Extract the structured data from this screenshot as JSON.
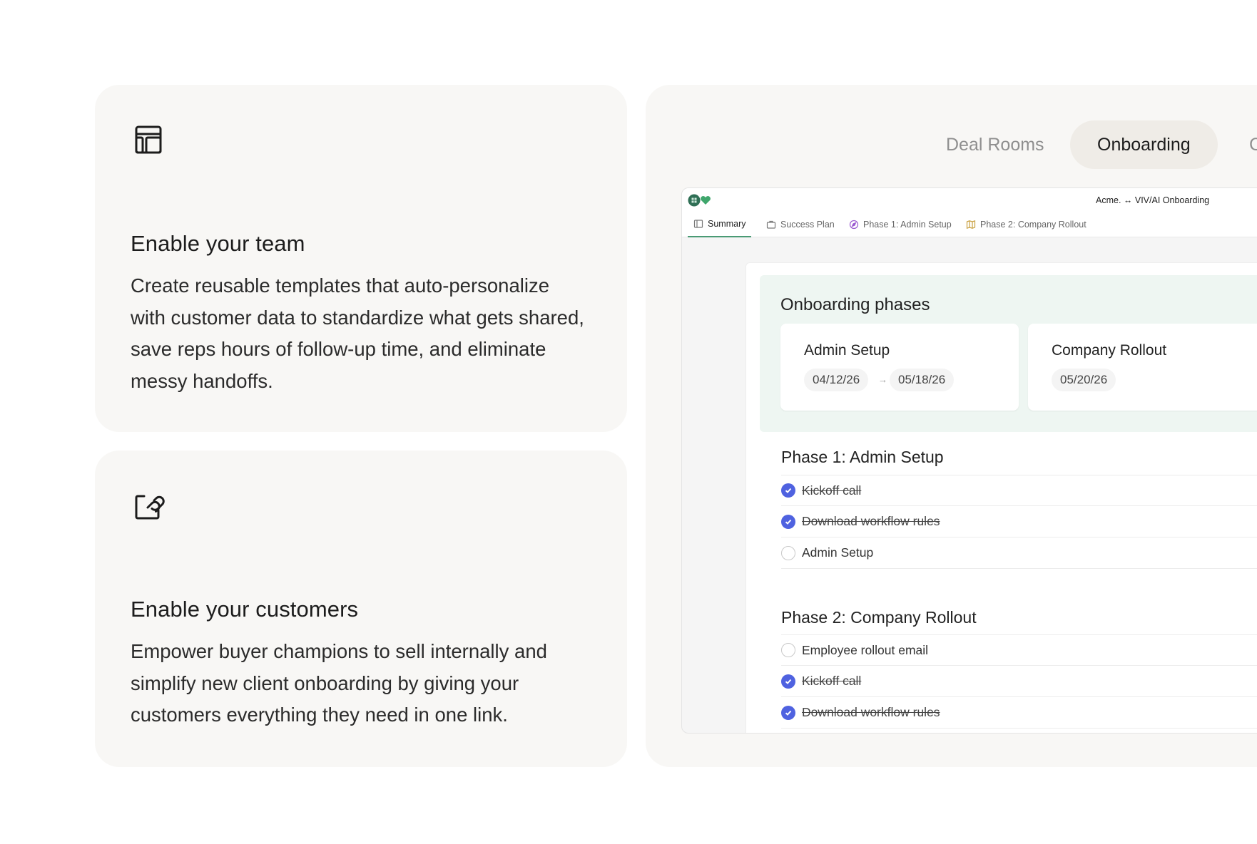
{
  "features": [
    {
      "icon": "layout-template-icon",
      "title": "Enable your team",
      "description": "Create reusable templates that auto-personalize with customer data to standardize what gets shared, save reps hours of follow-up time, and eliminate messy handoffs."
    },
    {
      "icon": "share-link-icon",
      "title": "Enable your customers",
      "description": "Empower buyer champions to sell internally and simplify new client onboarding by giving your customers everything they need in one link."
    }
  ],
  "showcase_tabs": {
    "items": [
      "Deal Rooms",
      "Onboarding",
      "C"
    ],
    "active": "Onboarding"
  },
  "app": {
    "title": "Acme. ↔ VIV/AI Onboarding",
    "tabs": [
      {
        "label": "Summary",
        "icon": "summary-icon",
        "active": true
      },
      {
        "label": "Success Plan",
        "icon": "briefcase-icon",
        "active": false
      },
      {
        "label": "Phase 1: Admin Setup",
        "icon": "compass-icon",
        "active": false
      },
      {
        "label": "Phase 2: Company Rollout",
        "icon": "map-icon",
        "active": false
      }
    ],
    "phases_title": "Onboarding phases",
    "phases": [
      {
        "name": "Admin Setup",
        "start": "04/12/26",
        "end": "05/18/26"
      },
      {
        "name": "Company Rollout",
        "start": "05/20/26"
      }
    ],
    "sections": [
      {
        "title": "Phase 1: Admin Setup",
        "tasks": [
          {
            "label": "Kickoff call",
            "done": true
          },
          {
            "label": "Download workflow rules",
            "done": true
          },
          {
            "label": "Admin Setup",
            "done": false
          }
        ]
      },
      {
        "title": "Phase 2: Company Rollout",
        "tasks": [
          {
            "label": "Employee rollout email",
            "done": false
          },
          {
            "label": "Kickoff call",
            "done": true
          },
          {
            "label": "Download workflow rules",
            "done": true
          }
        ]
      }
    ],
    "colors": {
      "check": "#4f62e0",
      "accent": "#4a9a74",
      "phases_bg": "#eef6f2"
    }
  }
}
